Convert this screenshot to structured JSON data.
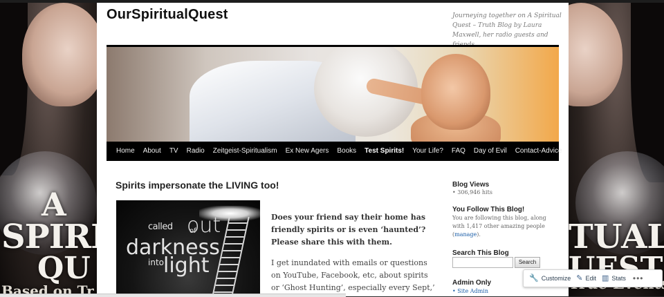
{
  "site": {
    "title": "OurSpiritualQuest",
    "description": "Journeying together on A Spiritual Quest – Truth Blog by Laura Maxwell, her radio guests and friends."
  },
  "background_art": {
    "left_lines": [
      "A",
      "SPIRIT",
      "QU",
      "Based on Tr"
    ],
    "right_lines": [
      "TUAL",
      "UEST",
      "True Events"
    ]
  },
  "nav": {
    "items": [
      "Home",
      "About",
      "TV",
      "Radio",
      "Zeitgeist-Spiritualism",
      "Ex New Agers",
      "Books",
      "Test Spirits!",
      "Your Life?",
      "FAQ",
      "Day of Evil",
      "Contact-Advice"
    ],
    "current": "Test Spirits!"
  },
  "post": {
    "title": "Spirits impersonate the LIVING too!",
    "image_text": [
      "called",
      "out",
      "of",
      "darkness",
      "into",
      "light"
    ],
    "lead": "Does your friend say their home has friendly spirits or is even ‘haunted’? Please share this with them.",
    "body": "I get inundated with emails or questions on YouTube, Facebook, etc, about spirits or ‘Ghost Hunting’, especially every Sept,’ Oct’"
  },
  "sidebar": {
    "blog_views_title": "Blog Views",
    "hits": "306,946 hits",
    "follow_title": "You Follow This Blog!",
    "follow_text_1": "You are following this blog, along with 1,417 other amazing people (",
    "follow_link": "manage",
    "follow_text_2": ").",
    "search_title": "Search This Blog",
    "search_button": "Search",
    "admin_title": "Admin Only",
    "site_admin": "Site Admin"
  },
  "actionbar": {
    "customize": "Customize",
    "edit": "Edit",
    "stats": "Stats",
    "more": "•••"
  },
  "icons": {
    "customize": "wrench-icon",
    "edit": "pencil-icon",
    "stats": "bar-chart-icon",
    "more": "ellipsis-icon"
  },
  "colors": {
    "nav_bg": "#000000",
    "link": "#1b5ea8",
    "page_bg": "#ffffff"
  }
}
